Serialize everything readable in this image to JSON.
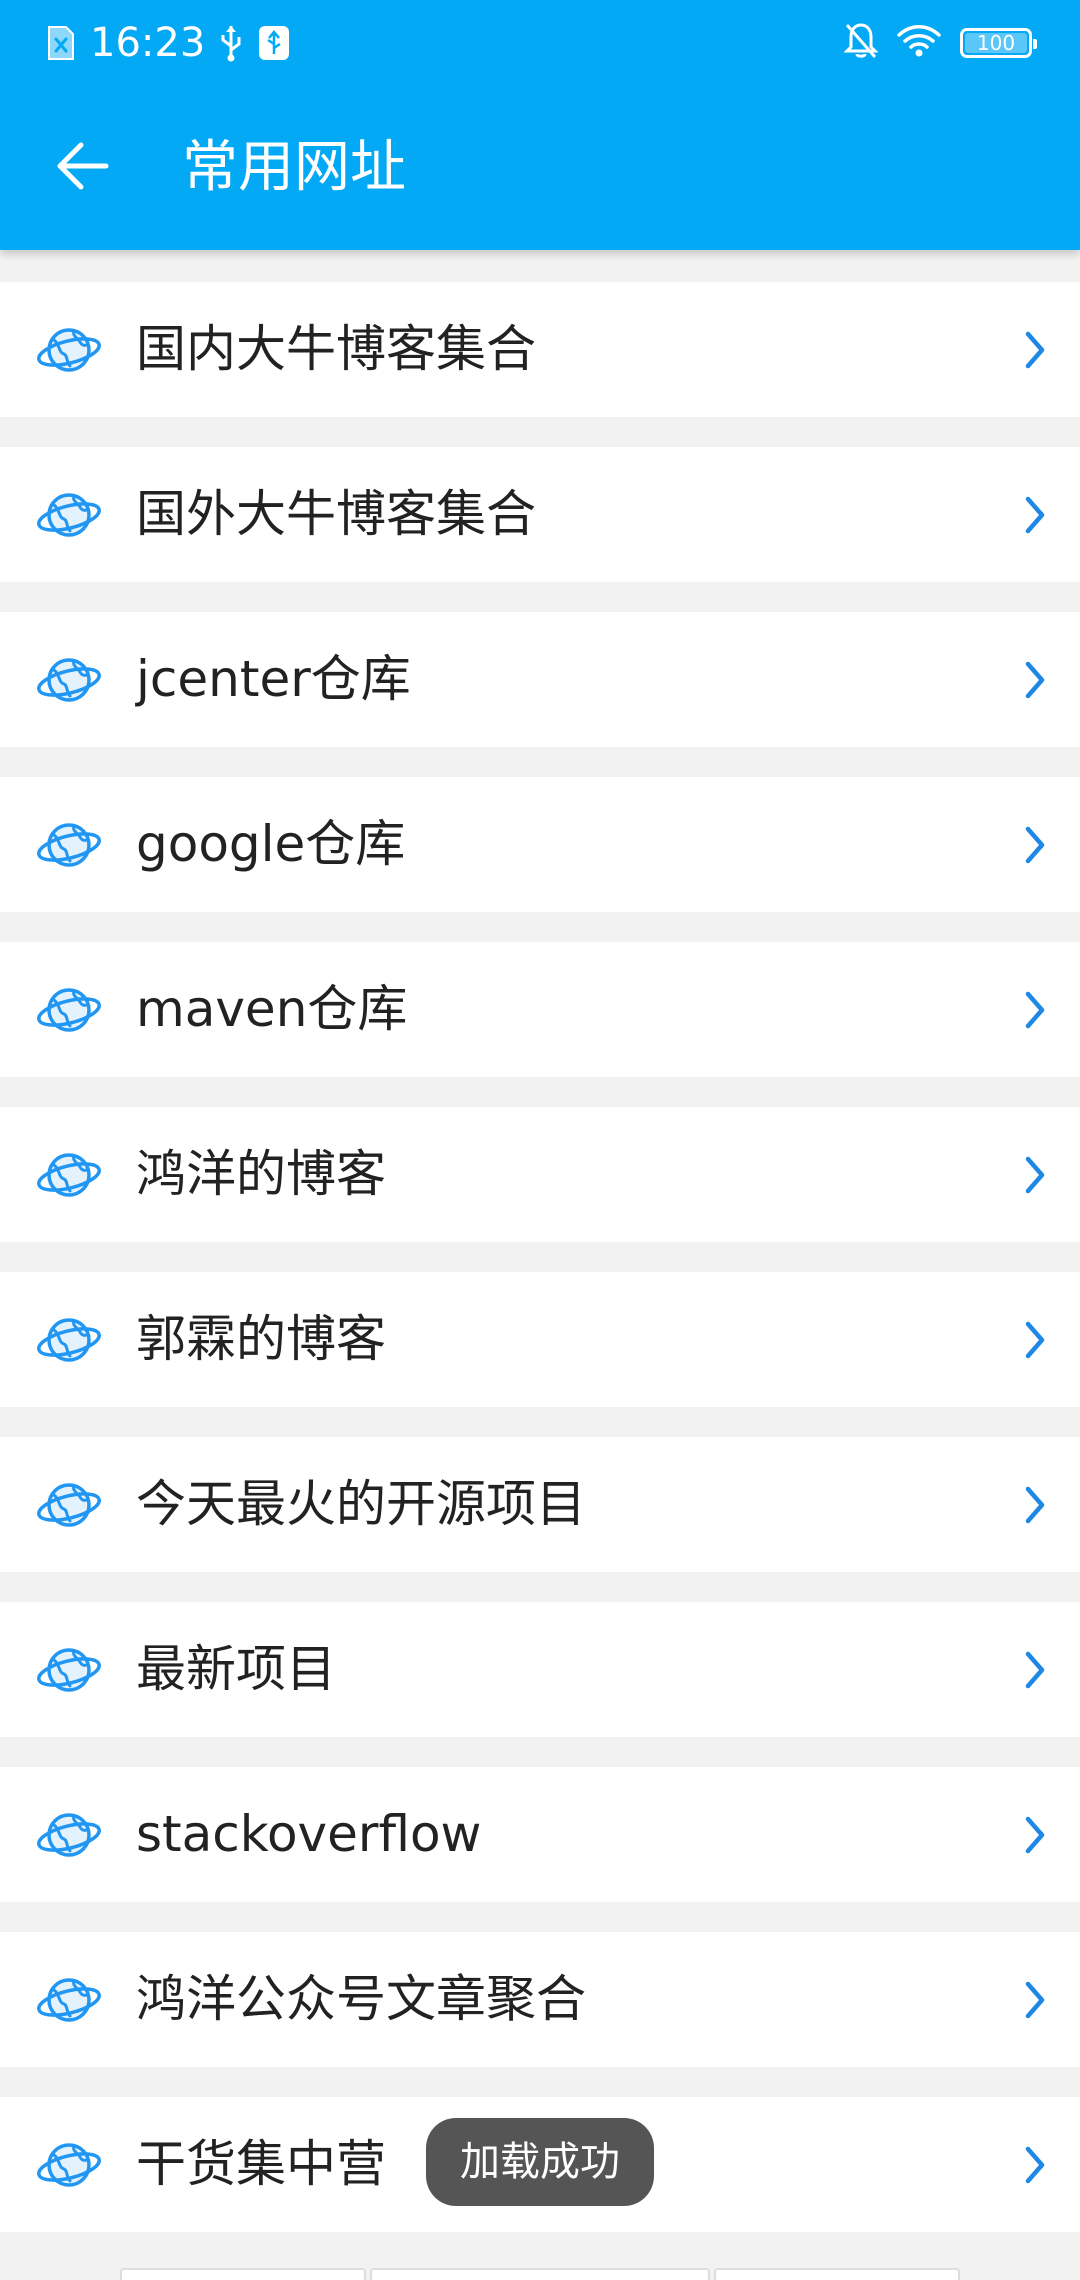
{
  "status_bar": {
    "time": "16:23",
    "battery_level": "100",
    "icons": [
      "sim-error-icon",
      "usb-icon",
      "usb-debug-icon",
      "notifications-off-icon",
      "wifi-icon",
      "battery-icon"
    ]
  },
  "toolbar": {
    "title": "常用网址",
    "back_icon": "arrow-left-icon",
    "background_color": "#03a9f4"
  },
  "list": {
    "item_icon": "globe-icon",
    "chevron_icon": "chevron-right-icon",
    "accent_color": "#1e88e5",
    "items": [
      {
        "label": "国内大牛博客集合"
      },
      {
        "label": "国外大牛博客集合"
      },
      {
        "label": "jcenter仓库"
      },
      {
        "label": "google仓库"
      },
      {
        "label": "maven仓库"
      },
      {
        "label": "鸿洋的博客"
      },
      {
        "label": "郭霖的博客"
      },
      {
        "label": "今天最火的开源项目"
      },
      {
        "label": "最新项目"
      },
      {
        "label": "stackoverflow"
      },
      {
        "label": "鸿洋公众号文章聚合"
      },
      {
        "label": "干货集中营"
      }
    ]
  },
  "toast": {
    "text": "加载成功"
  }
}
